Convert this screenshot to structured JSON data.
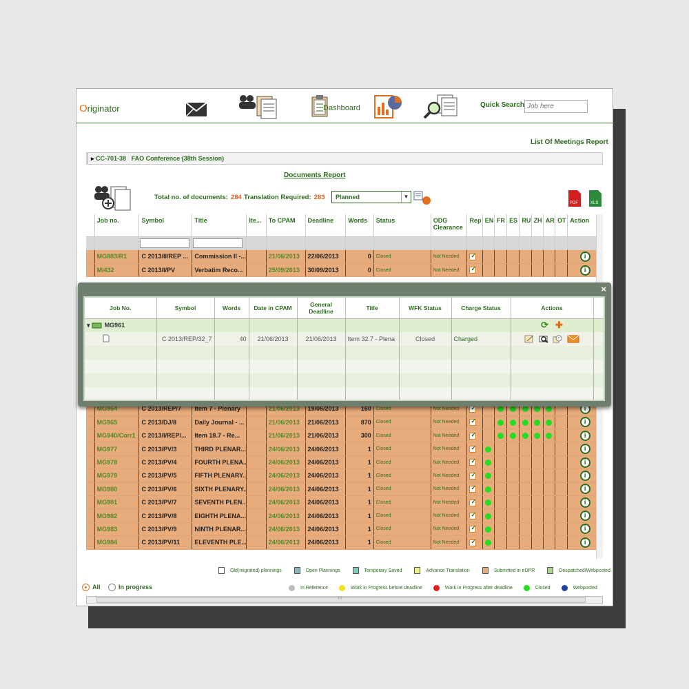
{
  "header": {
    "logo_first": "O",
    "logo_rest": "riginator",
    "dashboard_label": "Dashboard",
    "quick_search_label": "Quick Search",
    "quick_search_placeholder": "Job here"
  },
  "links": {
    "list_meetings": "List Of Meetings Report",
    "documents_report": "Documents Report"
  },
  "meeting": {
    "code": "CC-701-38",
    "name": "FAO Conference (38th Session)"
  },
  "summary": {
    "total_label": "Total no. of documents:",
    "total_value": "284",
    "translation_label": "Translation Required:",
    "translation_value": "283",
    "filter_value": "Planned"
  },
  "columns": [
    "Job no.",
    "Symbol",
    "Title",
    "Ite...",
    "To CPAM",
    "Deadline",
    "Words",
    "Status",
    "ODG Clearance",
    "Rep",
    "EN",
    "FR",
    "ES",
    "RU",
    "ZH",
    "AR",
    "OT",
    "Action"
  ],
  "rows_top": [
    {
      "job": "MG883/R1",
      "symbol": "C 2013/II/REP ...",
      "title": "Commission II -...",
      "cpam": "21/06/2013",
      "deadline": "22/06/2013",
      "words": "0",
      "status": "Closed",
      "odg": "Not Needed",
      "dots": []
    },
    {
      "job": "MI432",
      "symbol": "C 2013/I/PV",
      "title": "Verbatim Reco...",
      "cpam": "25/09/2013",
      "deadline": "30/09/2013",
      "words": "0",
      "status": "Closed",
      "odg": "Not Needed",
      "dots": []
    }
  ],
  "rows_bottom": [
    {
      "job": "MG964",
      "symbol": "C 2013/REP/7",
      "title": "Item 7 - Plenary",
      "cpam": "21/06/2013",
      "deadline": "19/06/2013",
      "words": "160",
      "status": "Closed",
      "odg": "Not Needed",
      "dots": [
        2,
        3,
        4,
        5,
        6
      ]
    },
    {
      "job": "MG965",
      "symbol": "C 2013/DJ/8",
      "title": "Daily Journal - ...",
      "cpam": "21/06/2013",
      "deadline": "21/06/2013",
      "words": "870",
      "status": "Closed",
      "odg": "Not Needed",
      "dots": [
        2,
        3,
        4,
        5,
        6
      ]
    },
    {
      "job": "MG940/Corr1",
      "symbol": "C 2013/I/REP/...",
      "title": "Item 18.7 - Re...",
      "cpam": "21/06/2013",
      "deadline": "21/06/2013",
      "words": "300",
      "status": "Closed",
      "odg": "Not Needed",
      "dots": [
        2,
        3,
        4,
        5,
        6
      ]
    },
    {
      "job": "MG977",
      "symbol": "C 2013/PV/3",
      "title": "THIRD PLENAR...",
      "cpam": "24/06/2013",
      "deadline": "24/06/2013",
      "words": "1",
      "status": "Closed",
      "odg": "Not Needed",
      "dots": [
        1
      ]
    },
    {
      "job": "MG978",
      "symbol": "C 2013/PV/4",
      "title": "FOURTH PLENA...",
      "cpam": "24/06/2013",
      "deadline": "24/06/2013",
      "words": "1",
      "status": "Closed",
      "odg": "Not Needed",
      "dots": [
        1
      ]
    },
    {
      "job": "MG979",
      "symbol": "C 2013/PV/5",
      "title": "FIFTH PLENARY...",
      "cpam": "24/06/2013",
      "deadline": "24/06/2013",
      "words": "1",
      "status": "Closed",
      "odg": "Not Needed",
      "dots": [
        1
      ]
    },
    {
      "job": "MG980",
      "symbol": "C 2013/PV/6",
      "title": "SIXTH PLENARY...",
      "cpam": "24/06/2013",
      "deadline": "24/06/2013",
      "words": "1",
      "status": "Closed",
      "odg": "Not Needed",
      "dots": [
        1
      ]
    },
    {
      "job": "MG981",
      "symbol": "C 2013/PV/7",
      "title": "SEVENTH PLEN...",
      "cpam": "24/06/2013",
      "deadline": "24/06/2013",
      "words": "1",
      "status": "Closed",
      "odg": "Not Needed",
      "dots": [
        1
      ]
    },
    {
      "job": "MG982",
      "symbol": "C 2013/PV/8",
      "title": "EIGHTH PLENA...",
      "cpam": "24/06/2013",
      "deadline": "24/06/2013",
      "words": "1",
      "status": "Closed",
      "odg": "Not Needed",
      "dots": [
        1
      ]
    },
    {
      "job": "MG983",
      "symbol": "C 2013/PV/9",
      "title": "NINTH PLENAR...",
      "cpam": "24/06/2013",
      "deadline": "24/06/2013",
      "words": "1",
      "status": "Closed",
      "odg": "Not Needed",
      "dots": [
        1
      ]
    },
    {
      "job": "MG984",
      "symbol": "C 2013/PV/11",
      "title": "ELEVENTH PLE...",
      "cpam": "24/06/2013",
      "deadline": "24/06/2013",
      "words": "1",
      "status": "Closed",
      "odg": "Not Needed",
      "dots": [
        1
      ]
    }
  ],
  "popup": {
    "close": "×",
    "columns": [
      "Job No.",
      "Symbol",
      "Words",
      "Date in CPAM",
      "General Deadline",
      "Title",
      "WFK Status",
      "Charge Status",
      "Actions"
    ],
    "group_job": "MG961",
    "detail": {
      "symbol": "C 2013/REP/32_7",
      "words": "40",
      "cpam": "21/06/2013",
      "deadline": "21/06/2013",
      "title": "Item 32.7 - Plena",
      "wfk": "Closed",
      "charge": "Charged"
    }
  },
  "legend_status": [
    {
      "label": "Old(migrated) plannings",
      "color": "#ffffff"
    },
    {
      "label": "Open Plannings",
      "color": "#8fb4bc"
    },
    {
      "label": "Temporary Saved",
      "color": "#7fcfc0"
    },
    {
      "label": "Advance Translation",
      "color": "#f0f090"
    },
    {
      "label": "Submitted in eDPR",
      "color": "#e8ac7c"
    },
    {
      "label": "Despatched/Webposted",
      "color": "#a8d890"
    }
  ],
  "legend_dots": [
    {
      "label": "In Reference",
      "color": "#bbbbbb"
    },
    {
      "label": "Work in Progress before deadline",
      "color": "#f0e020"
    },
    {
      "label": "Work in Progress after deadline",
      "color": "#e02020"
    },
    {
      "label": "Closed",
      "color": "#22dd22"
    },
    {
      "label": "Webposted",
      "color": "#2040a0"
    }
  ],
  "radios": {
    "all": "All",
    "in_progress": "In progress"
  },
  "hscroll_grip": "III"
}
